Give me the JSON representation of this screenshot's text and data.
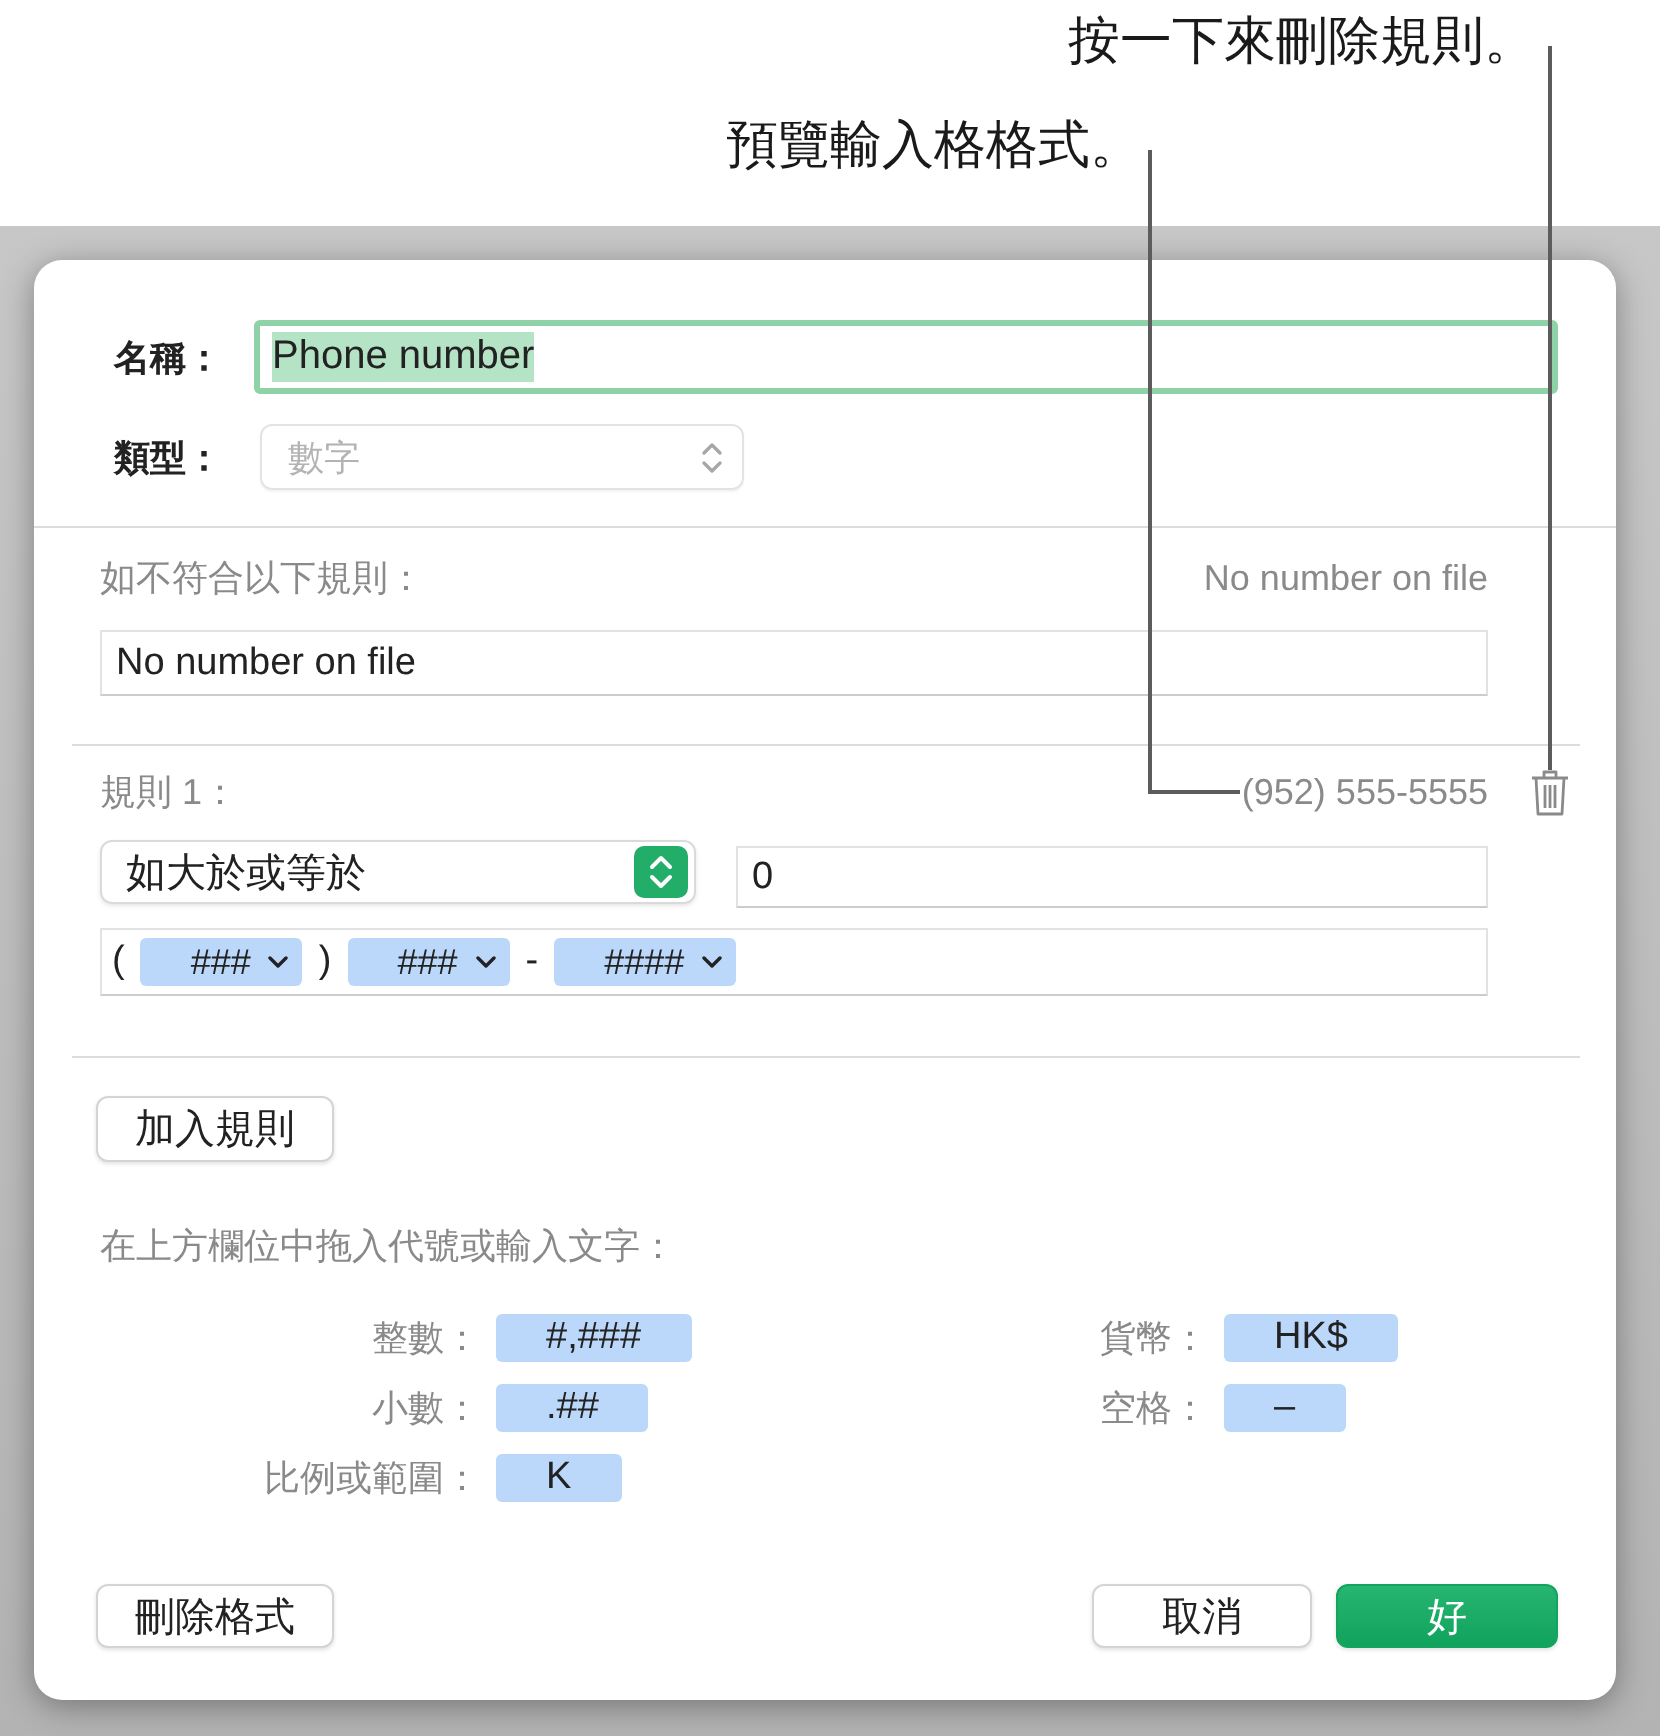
{
  "callouts": [
    {
      "kind": "delete-rule",
      "text": "按一下來刪除規則。"
    },
    {
      "kind": "preview",
      "text": "預覽輸入格格式。"
    }
  ],
  "name_field": {
    "label": "名稱：",
    "value": "Phone number",
    "focused": true,
    "text_selected": true
  },
  "type_field": {
    "label": "類型：",
    "value": "數字",
    "disabled": true
  },
  "fallback": {
    "label": "如不符合以下規則：",
    "preview": "No number on file",
    "value": "No number on file"
  },
  "rules": [
    {
      "label": "規則 1：",
      "preview": "(952) 555-5555",
      "condition": "如大於或等於",
      "value": "0",
      "format": [
        {
          "kind": "literal",
          "text": "("
        },
        {
          "kind": "token",
          "text": "###"
        },
        {
          "kind": "literal",
          "text": ")"
        },
        {
          "kind": "token",
          "text": "###"
        },
        {
          "kind": "literal",
          "text": "-"
        },
        {
          "kind": "token",
          "text": "####"
        }
      ]
    }
  ],
  "add_rule_button": "加入規則",
  "tokens_hint": "在上方欄位中拖入代號或輸入文字：",
  "tokens": [
    {
      "label": "整數：",
      "token": "#,###"
    },
    {
      "label": "貨幣：",
      "token": "HK$"
    },
    {
      "label": "小數：",
      "token": ".##"
    },
    {
      "label": "空格：",
      "token": "–"
    },
    {
      "label": "比例或範圍：",
      "token": "K"
    }
  ],
  "buttons": [
    {
      "label": "刪除格式",
      "default": false
    },
    {
      "label": "取消",
      "default": false
    },
    {
      "label": "好",
      "default": true
    }
  ]
}
